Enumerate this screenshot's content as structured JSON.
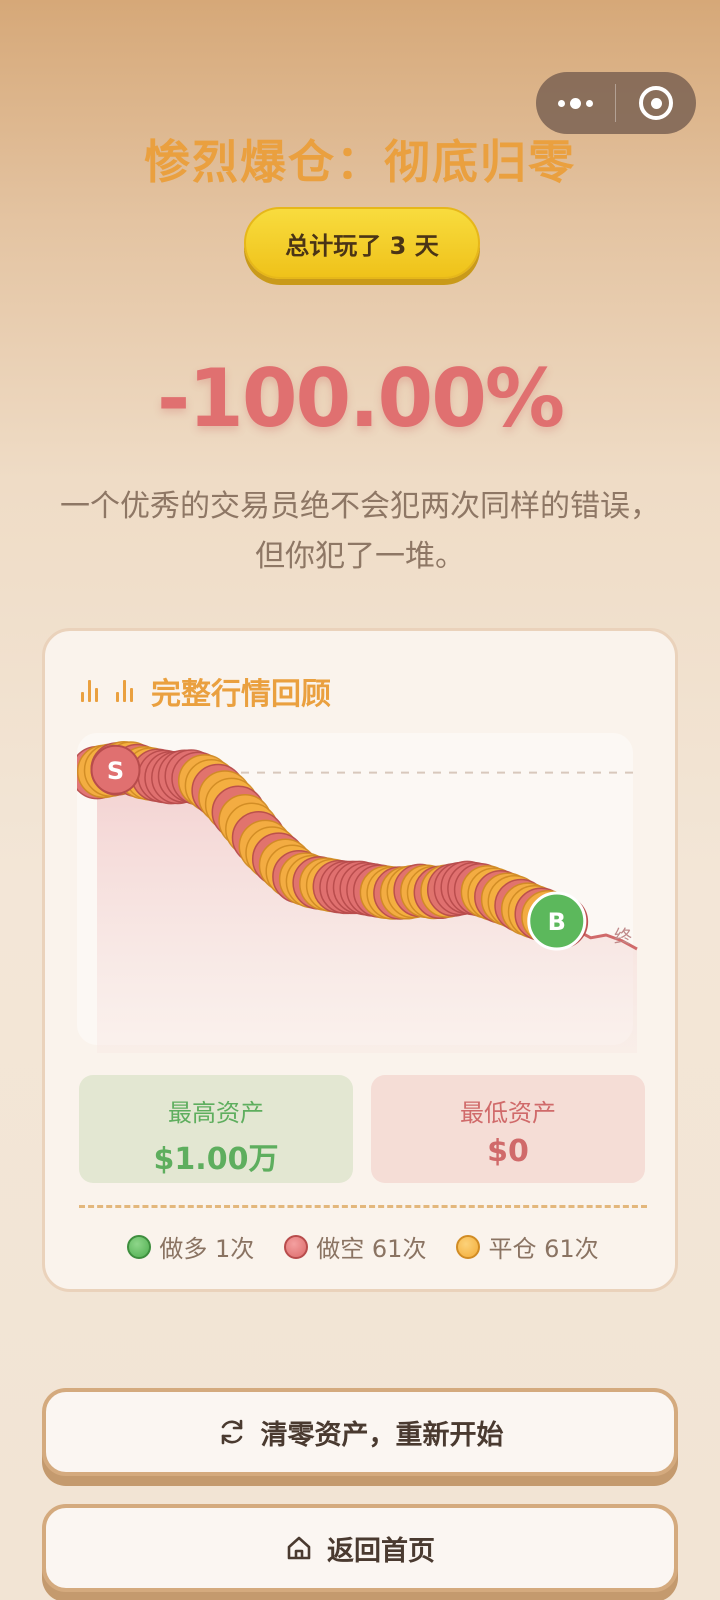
{
  "result": {
    "title": "惨烈爆仓：彻底归零",
    "days_label": "总计玩了 3 天",
    "percent": "-100.00%",
    "quote": "一个优秀的交易员绝不会犯两次同样的错误，但你犯了一堆。"
  },
  "review": {
    "title": "完整行情回顾",
    "high_label": "最高资产",
    "high_value": "$1.00万",
    "low_label": "最低资产",
    "low_value": "$0",
    "legend": {
      "long": "做多 1次",
      "short": "做空 61次",
      "close": "平仓 61次"
    }
  },
  "chart_data": {
    "type": "line",
    "title": "完整行情回顾",
    "series": [
      {
        "y": [
          0.93,
          0.94,
          0.95,
          0.93,
          0.92,
          0.91,
          0.92,
          0.9,
          0.86,
          0.8,
          0.73,
          0.66,
          0.61,
          0.56,
          0.54,
          0.53,
          0.52,
          0.52,
          0.51,
          0.5,
          0.5,
          0.51,
          0.5,
          0.51,
          0.52,
          0.51,
          0.49,
          0.47,
          0.44,
          0.42,
          0.4,
          0.37,
          0.34,
          0.35,
          0.33,
          0.3
        ]
      }
    ],
    "reference_line": 0.93,
    "markers": {
      "start": "S",
      "buy": "B",
      "end": "终"
    },
    "colors": {
      "line": "#d06a6a",
      "area": "#f4d4d0",
      "long": "#5cb85c",
      "short": "#e07070",
      "close": "#f5b040"
    }
  },
  "buttons": {
    "restart": "清零资产，重新开始",
    "home": "返回首页"
  },
  "icons": {
    "capsule_more": "more-dots-icon",
    "capsule_close": "target-close-icon",
    "title_icon": "bar-chart-icon",
    "restart_icon": "refresh-icon",
    "home_icon": "home-icon"
  }
}
